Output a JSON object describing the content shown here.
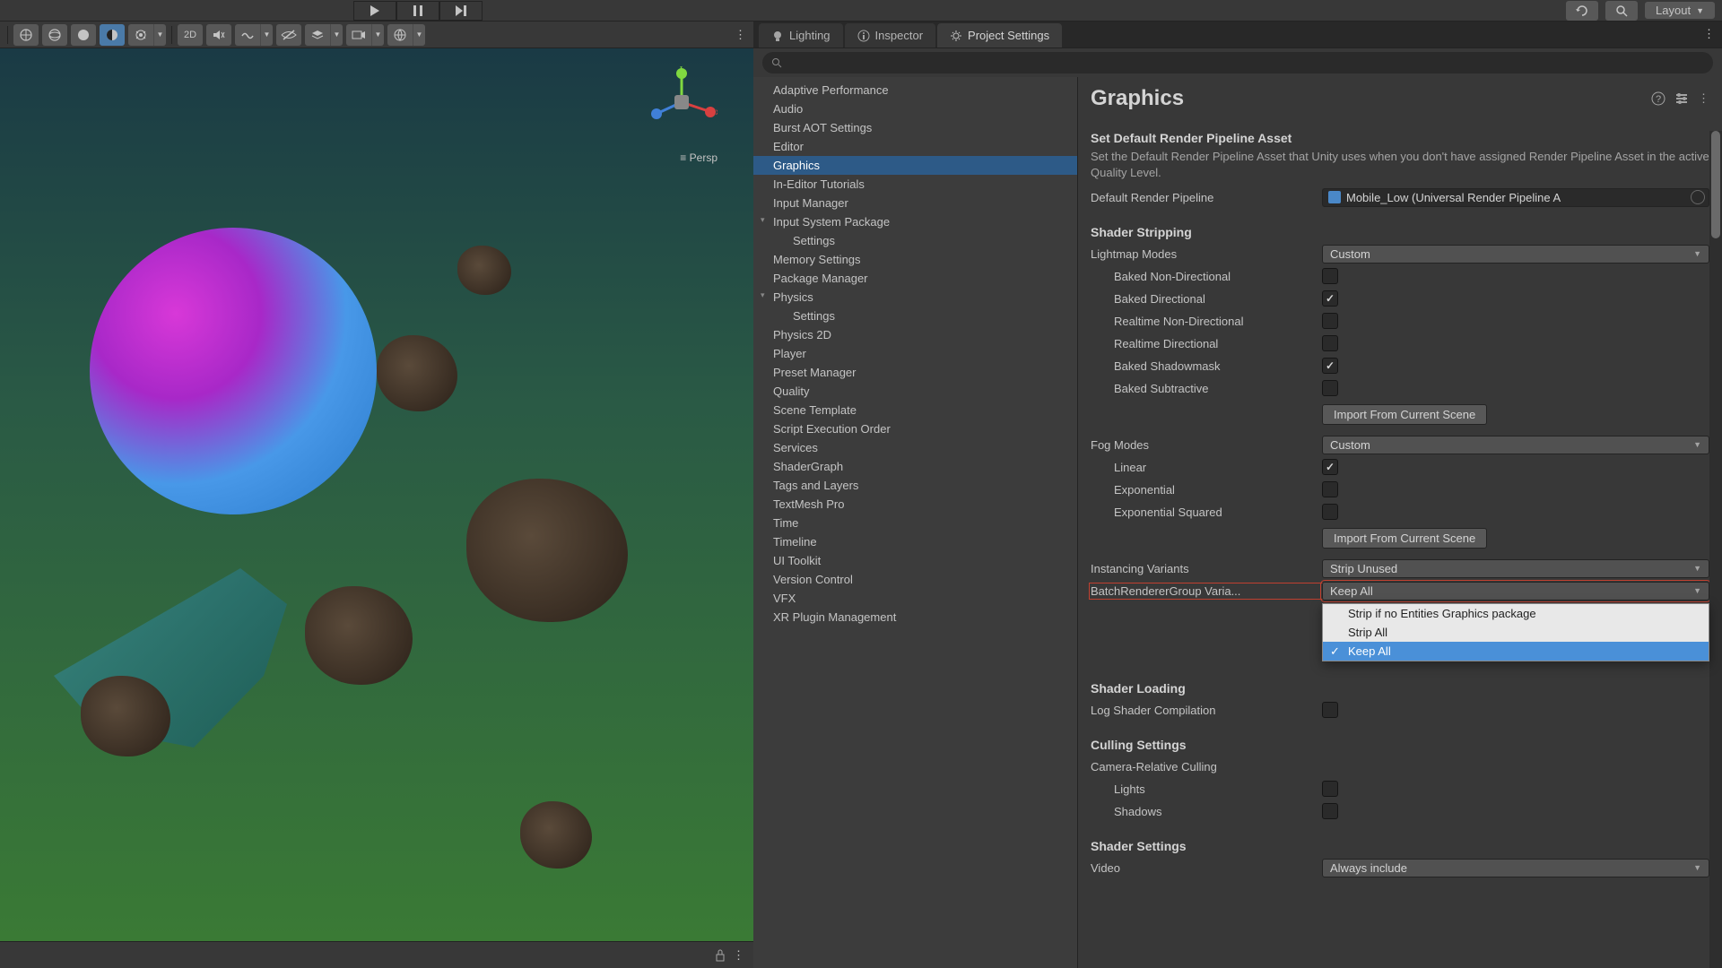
{
  "toolbar": {
    "layout_label": "Layout"
  },
  "scene": {
    "persp_label": "Persp",
    "mode_2d": "2D"
  },
  "tabs": {
    "lighting": "Lighting",
    "inspector": "Inspector",
    "project_settings": "Project Settings"
  },
  "sidebar": {
    "items": [
      "Adaptive Performance",
      "Audio",
      "Burst AOT Settings",
      "Editor",
      "Graphics",
      "In-Editor Tutorials",
      "Input Manager",
      "Input System Package",
      "Settings",
      "Memory Settings",
      "Package Manager",
      "Physics",
      "Settings",
      "Physics 2D",
      "Player",
      "Preset Manager",
      "Quality",
      "Scene Template",
      "Script Execution Order",
      "Services",
      "ShaderGraph",
      "Tags and Layers",
      "TextMesh Pro",
      "Time",
      "Timeline",
      "UI Toolkit",
      "Version Control",
      "VFX",
      "XR Plugin Management"
    ]
  },
  "graphics": {
    "title": "Graphics",
    "default_rp_section": "Set Default Render Pipeline Asset",
    "default_rp_desc": "Set the Default Render Pipeline Asset that Unity uses when you don't have assigned Render Pipeline Asset in the active Quality Level.",
    "default_rp_label": "Default Render Pipeline",
    "default_rp_value": "Mobile_Low (Universal Render Pipeline A",
    "shader_stripping": "Shader Stripping",
    "lightmap_modes": "Lightmap Modes",
    "lightmap_value": "Custom",
    "baked_non_dir": "Baked Non-Directional",
    "baked_dir": "Baked Directional",
    "realtime_non_dir": "Realtime Non-Directional",
    "realtime_dir": "Realtime Directional",
    "baked_shadowmask": "Baked Shadowmask",
    "baked_subtractive": "Baked Subtractive",
    "import_btn": "Import From Current Scene",
    "fog_modes": "Fog Modes",
    "fog_value": "Custom",
    "linear": "Linear",
    "exponential": "Exponential",
    "exponential_sq": "Exponential Squared",
    "instancing_variants": "Instancing Variants",
    "instancing_value": "Strip Unused",
    "brg_variants": "BatchRendererGroup Varia...",
    "brg_value": "Keep All",
    "shader_loading": "Shader Loading",
    "log_shader": "Log Shader Compilation",
    "culling_settings": "Culling Settings",
    "camera_relative": "Camera-Relative Culling",
    "lights": "Lights",
    "shadows": "Shadows",
    "shader_settings": "Shader Settings",
    "video": "Video",
    "video_value": "Always include"
  },
  "dropdown_popup": {
    "items": [
      "Strip if no Entities Graphics package",
      "Strip All",
      "Keep All"
    ]
  }
}
